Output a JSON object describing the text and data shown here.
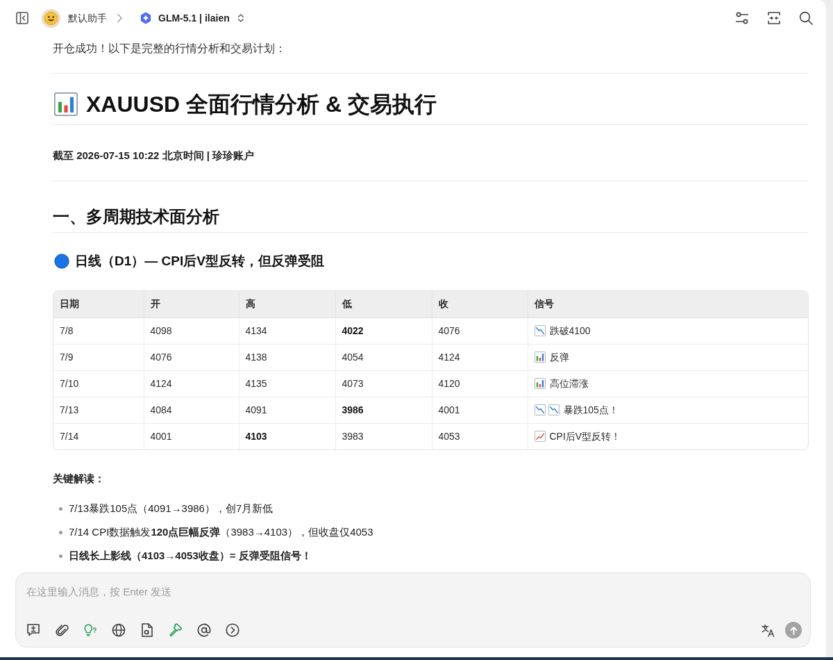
{
  "header": {
    "assistant": "默认助手",
    "model": "GLM-5.1 | ilaien"
  },
  "message": {
    "intro": "开仓成功！以下是完整的行情分析和交易计划：",
    "title": "XAUUSD 全面行情分析 & 交易执行",
    "timestamp": "截至 2026-07-15 10:22 北京时间 | 珍珍账户",
    "section": "一、多周期技术面分析",
    "subsection": "日线（D1）— CPI后V型反转，但反弹受阻",
    "table": {
      "columns": [
        "日期",
        "开",
        "高",
        "低",
        "收",
        "信号"
      ],
      "rows": [
        {
          "cells": [
            {
              "text": "7/8",
              "bold": false
            },
            {
              "text": "4098",
              "bold": false
            },
            {
              "text": "4134",
              "bold": false
            },
            {
              "text": "4022",
              "bold": true
            },
            {
              "text": "4076",
              "bold": false
            }
          ],
          "signal": {
            "icons": [
              {
                "kind": "chart_down"
              }
            ],
            "text": "跌破4100"
          }
        },
        {
          "cells": [
            {
              "text": "7/9",
              "bold": false
            },
            {
              "text": "4076",
              "bold": false
            },
            {
              "text": "4138",
              "bold": false
            },
            {
              "text": "4054",
              "bold": false
            },
            {
              "text": "4124",
              "bold": false
            }
          ],
          "signal": {
            "icons": [
              {
                "kind": "bar_chart"
              }
            ],
            "text": "反弹"
          }
        },
        {
          "cells": [
            {
              "text": "7/10",
              "bold": false
            },
            {
              "text": "4124",
              "bold": false
            },
            {
              "text": "4135",
              "bold": false
            },
            {
              "text": "4073",
              "bold": false
            },
            {
              "text": "4120",
              "bold": false
            }
          ],
          "signal": {
            "icons": [
              {
                "kind": "bar_chart"
              }
            ],
            "text": "高位滞涨"
          }
        },
        {
          "cells": [
            {
              "text": "7/13",
              "bold": false
            },
            {
              "text": "4084",
              "bold": false
            },
            {
              "text": "4091",
              "bold": false
            },
            {
              "text": "3986",
              "bold": true
            },
            {
              "text": "4001",
              "bold": false
            }
          ],
          "signal": {
            "icons": [
              {
                "kind": "chart_down"
              },
              {
                "kind": "chart_down"
              }
            ],
            "text": "暴跌105点！"
          }
        },
        {
          "cells": [
            {
              "text": "7/14",
              "bold": false
            },
            {
              "text": "4001",
              "bold": false
            },
            {
              "text": "4103",
              "bold": true
            },
            {
              "text": "3983",
              "bold": false
            },
            {
              "text": "4053",
              "bold": false
            }
          ],
          "signal": {
            "icons": [
              {
                "kind": "chart_up"
              }
            ],
            "text": "CPI后V型反转！"
          }
        }
      ]
    },
    "key_title": "关键解读：",
    "bullets": [
      {
        "text": "7/13暴跌105点（4091→3986），创7月新低",
        "bold": false
      },
      {
        "text": "7/14 CPI数据触发**120点巨幅反弹**（3983→4103），但收盘仅4053",
        "bold": false
      },
      {
        "text": "日线长上影线（4103→4053收盘）= 反弹受阻信号！",
        "bold": true
      }
    ]
  },
  "composer": {
    "placeholder": "在这里输入消息，按 Enter 发送",
    "tools": [
      {
        "kind": "message_plus",
        "active": false
      },
      {
        "kind": "paperclip",
        "active": false
      },
      {
        "kind": "lightbulb",
        "active": true
      },
      {
        "kind": "globe",
        "active": false
      },
      {
        "kind": "document",
        "active": false
      },
      {
        "kind": "hammer",
        "active": true
      },
      {
        "kind": "at",
        "active": false
      },
      {
        "kind": "arrow_circle",
        "active": false
      }
    ],
    "send": {
      "disabled": true
    }
  }
}
